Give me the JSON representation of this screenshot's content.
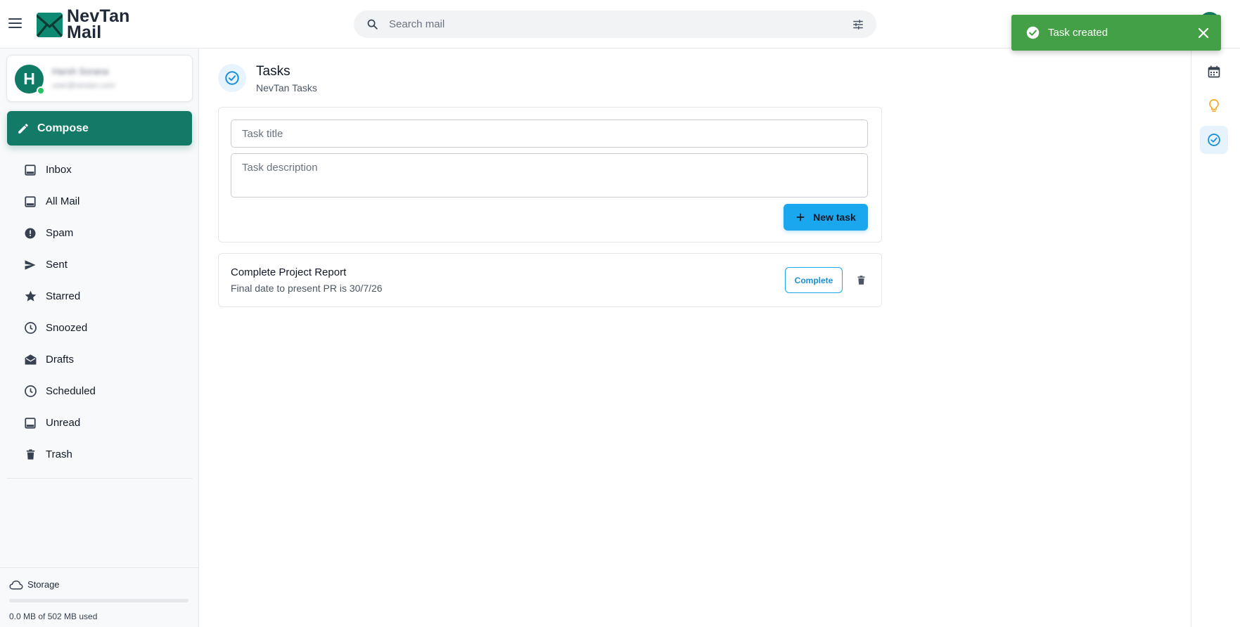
{
  "app": {
    "logo_line1": "NevTan",
    "logo_line2": "Mail",
    "brand_color": "#137a68"
  },
  "search": {
    "placeholder": "Search mail"
  },
  "toast": {
    "message": "Task created",
    "color": "#43a047"
  },
  "profile": {
    "initial": "H",
    "name": "Harsh Sorana",
    "email": "user@nevtan.com"
  },
  "compose": {
    "label": "Compose"
  },
  "sidebar": {
    "items": [
      {
        "label": "Inbox",
        "icon": "inbox-icon"
      },
      {
        "label": "All Mail",
        "icon": "all-mail-icon"
      },
      {
        "label": "Spam",
        "icon": "spam-icon"
      },
      {
        "label": "Sent",
        "icon": "send-icon"
      },
      {
        "label": "Starred",
        "icon": "star-icon"
      },
      {
        "label": "Snoozed",
        "icon": "clock-icon"
      },
      {
        "label": "Drafts",
        "icon": "drafts-icon"
      },
      {
        "label": "Scheduled",
        "icon": "schedule-icon"
      },
      {
        "label": "Unread",
        "icon": "unread-icon"
      },
      {
        "label": "Trash",
        "icon": "trash-icon"
      }
    ]
  },
  "storage": {
    "label": "Storage",
    "used_text": "0.0 MB of 502 MB used",
    "used_fraction": 0.0
  },
  "tasks": {
    "title": "Tasks",
    "subtitle": "NevTan Tasks",
    "title_placeholder": "Task title",
    "description_placeholder": "Task description",
    "new_task_label": "New task",
    "accent_color": "#1ba7ee",
    "list": [
      {
        "title": "Complete Project Report",
        "description": "Final date to present PR is 30/7/26",
        "complete_label": "Complete"
      }
    ]
  },
  "rail": {
    "items": [
      "calendar-icon",
      "keep-bulb-icon",
      "tasks-check-icon"
    ],
    "active": "tasks-check-icon"
  }
}
